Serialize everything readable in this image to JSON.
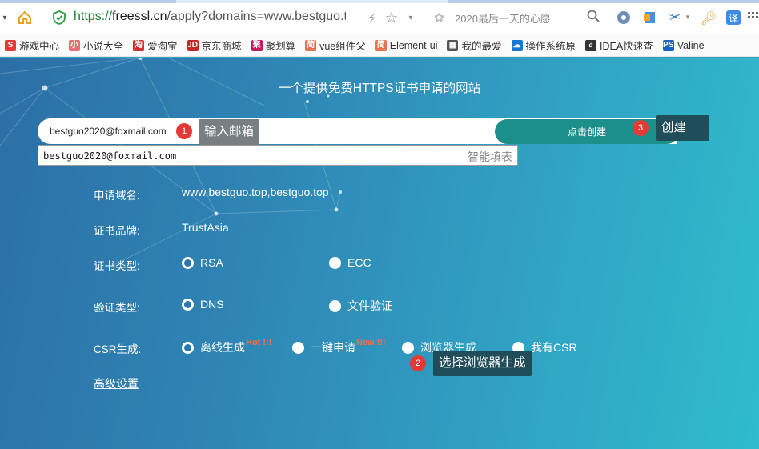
{
  "browser": {
    "url_scheme": "https://",
    "url_host": "freessl.cn",
    "url_path": "/apply?domains=www.bestguo.to",
    "search_placeholder": "2020最后一天的心愿"
  },
  "bookmarks": [
    {
      "label": "游戏中心",
      "icon": "game-icon",
      "color": "#e53935"
    },
    {
      "label": "小说大全",
      "icon": "book-icon",
      "color": "#e57373"
    },
    {
      "label": "爱淘宝",
      "icon": "taobao-icon",
      "color": "#d32f2f"
    },
    {
      "label": "京东商城",
      "icon": "jd-icon",
      "color": "#c62828"
    },
    {
      "label": "聚划算",
      "icon": "juhuasuan-icon",
      "color": "#c2185b"
    },
    {
      "label": "vue组件父",
      "icon": "jian-icon",
      "color": "#e57350"
    },
    {
      "label": "Element-ui",
      "icon": "jian-icon",
      "color": "#e57350"
    },
    {
      "label": "我的最爱",
      "icon": "grid-icon",
      "color": "#555555"
    },
    {
      "label": "操作系统原",
      "icon": "cloud-icon",
      "color": "#1976d2"
    },
    {
      "label": "IDEA快速查",
      "icon": "idea-icon",
      "color": "#333333"
    },
    {
      "label": "Valine --",
      "icon": "ps-icon",
      "color": "#1565c0"
    }
  ],
  "header": {
    "tagline": "一个提供免费HTTPS证书申请的网站"
  },
  "apply": {
    "email_value": "bestguo2020@foxmail.com",
    "create_label": "点击创建",
    "autofill_value": "bestguo2020@foxmail.com",
    "autofill_hint": "智能填表"
  },
  "annotations": {
    "step1_num": "1",
    "step1_text": "输入邮箱",
    "step2_num": "2",
    "step2_text": "选择浏览器生成",
    "step3_num": "3",
    "step3_text": "创建"
  },
  "form": {
    "domain_label": "申请域名:",
    "domain_value": "www.bestguo.top,bestguo.top",
    "brand_label": "证书品牌:",
    "brand_value": "TrustAsia",
    "cert_type_label": "证书类型:",
    "cert_type_options": [
      "RSA",
      "ECC"
    ],
    "cert_type_selected": "RSA",
    "verify_label": "验证类型:",
    "verify_options": [
      "DNS",
      "文件验证"
    ],
    "verify_selected": "DNS",
    "csr_label": "CSR生成:",
    "csr_options": [
      "离线生成",
      "一键申请",
      "浏览器生成",
      "我有CSR"
    ],
    "csr_sup_hot": "Hot !!!",
    "csr_sup_new": "New !!!",
    "csr_selected": "离线生成",
    "advanced_label": "高级设置"
  }
}
